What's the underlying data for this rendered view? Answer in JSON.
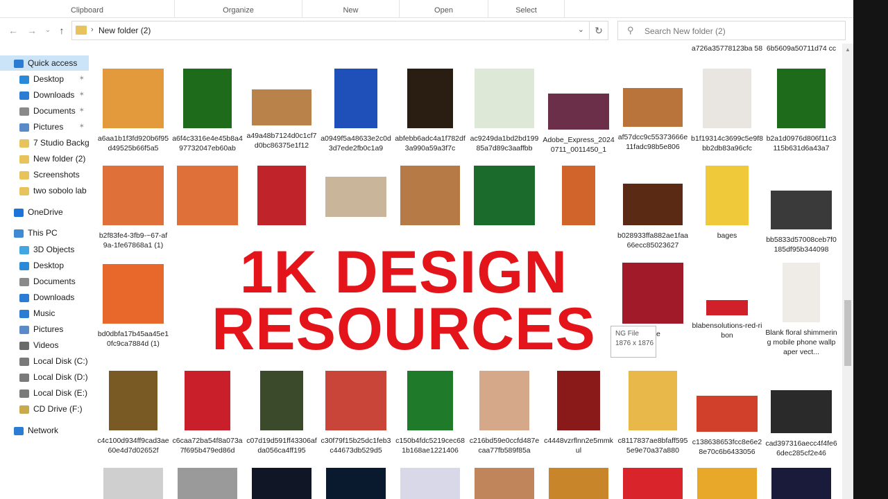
{
  "ribbon": [
    "Clipboard",
    "Organize",
    "New",
    "Open",
    "Select"
  ],
  "address": {
    "path": "New folder (2)"
  },
  "search": {
    "placeholder": "Search New folder (2)"
  },
  "nav": {
    "items": [
      {
        "label": "Quick access",
        "color": "#2b7cd3",
        "pinned": false,
        "selected": true
      },
      {
        "label": "Desktop",
        "color": "#2b8ad8",
        "pinned": true
      },
      {
        "label": "Downloads",
        "color": "#2b7cd3",
        "pinned": true
      },
      {
        "label": "Documents",
        "color": "#8a8a8a",
        "pinned": true
      },
      {
        "label": "Pictures",
        "color": "#5a8ac8",
        "pinned": true
      },
      {
        "label": "7 Studio Backg",
        "color": "#e8c35c",
        "pinned": false
      },
      {
        "label": "New folder (2)",
        "color": "#e8c35c",
        "pinned": false
      },
      {
        "label": "Screenshots",
        "color": "#e8c35c",
        "pinned": false
      },
      {
        "label": "two sobolo lab",
        "color": "#e8c35c",
        "pinned": false
      },
      {
        "label": "OneDrive",
        "color": "#1d74d8",
        "pinned": false
      },
      {
        "label": "This PC",
        "color": "#3e8ad3",
        "pinned": false
      },
      {
        "label": "3D Objects",
        "color": "#41a7e0",
        "pinned": false
      },
      {
        "label": "Desktop",
        "color": "#2b8ad8",
        "pinned": false
      },
      {
        "label": "Documents",
        "color": "#8a8a8a",
        "pinned": false
      },
      {
        "label": "Downloads",
        "color": "#2b7cd3",
        "pinned": false
      },
      {
        "label": "Music",
        "color": "#2b7cd3",
        "pinned": false
      },
      {
        "label": "Pictures",
        "color": "#5a8ac8",
        "pinned": false
      },
      {
        "label": "Videos",
        "color": "#6a6a6a",
        "pinned": false
      },
      {
        "label": "Local Disk (C:)",
        "color": "#7a7a7a",
        "pinned": false
      },
      {
        "label": "Local Disk (D:)",
        "color": "#7a7a7a",
        "pinned": false
      },
      {
        "label": "Local Disk (E:)",
        "color": "#7a7a7a",
        "pinned": false
      },
      {
        "label": "CD Drive (F:)",
        "color": "#c9a94a",
        "pinned": false
      },
      {
        "label": "Network",
        "color": "#2b7cd3",
        "pinned": false
      }
    ]
  },
  "files": {
    "row0": [
      "a726a35778123ba 58",
      "6b5609a50711d74 cc"
    ],
    "row1": [
      {
        "name": "a6aa1b1f3fd920b6f95d49525b66f5a5",
        "color": "#e39a3c"
      },
      {
        "name": "a6f4c3316e4e45b8a497732047eb60ab",
        "color": "#1f6b1c"
      },
      {
        "name": "a49a48b7124d0c1cf7d0bc86375e1f12",
        "color": "#b9824a"
      },
      {
        "name": "a0949f5a48633e2c0d3d7ede2fb0c1a9",
        "color": "#1f4fb8"
      },
      {
        "name": "abfebb6adc4a1f782df3a990a59a3f7c",
        "color": "#2a1e12"
      },
      {
        "name": "ac9249da1bd2bd19985a7d89c3aaffbb",
        "color": "#dde8d6"
      },
      {
        "name": "Adobe_Express_20240711_0011450_1",
        "color": "#6b2f4a"
      },
      {
        "name": "af57dcc9c55373666e11fadc98b5e806",
        "color": "#b8743a"
      },
      {
        "name": "b1f19314c3699c5e9f8bb2db83a96cfc",
        "color": "#e9e5e0"
      },
      {
        "name": "b2a1d0976d806f11c3115b631d6a43a7",
        "color": "#1f6b1c"
      }
    ],
    "row2": [
      {
        "name": "b2f83fe4-3fb9-~67-af9a-1fe67868a1 (1)",
        "color": "#e0703a"
      },
      {
        "name": "",
        "color": "#e0703a"
      },
      {
        "name": "",
        "color": "#c0232a"
      },
      {
        "name": "",
        "color": "#c9b59a"
      },
      {
        "name": "",
        "color": "#b57a45"
      },
      {
        "name": "",
        "color": "#1a6b2c"
      },
      {
        "name": "",
        "color": "#d0642a"
      },
      {
        "name": "b028933ffa882ae1faa66ecc85023627",
        "color": "#5a2a14"
      },
      {
        "name": "bages",
        "color": "#f0c93a"
      },
      {
        "name": "bb5833d57008ceb7f0185df95b344098",
        "color": "#3a3a3a"
      }
    ],
    "row3": [
      {
        "name": "bd0dbfa17b45aa45e10fc9ca7884d (1)",
        "color": "#e8672a"
      },
      {
        "name": "juice",
        "color": "#a01a2a"
      },
      {
        "name": "blabensolutions-red-ribon",
        "color": "#d0202a"
      },
      {
        "name": "Blank floral shimmering mobile phone wallpaper vect...",
        "color": "#efebe6"
      }
    ],
    "row4": [
      {
        "name": "c4c100d934ff9cad3ae60e4d7d02652f",
        "color": "#7a5a24"
      },
      {
        "name": "c6caa72ba54f8a073a7f695b479ed86d",
        "color": "#c81f2a"
      },
      {
        "name": "c07d19d591ff43306afda056ca4ff195",
        "color": "#3a4a2a"
      },
      {
        "name": "c30f79f15b25dc1feb3c44673db529d5",
        "color": "#c9453a"
      },
      {
        "name": "c150b4fdc5219cec681b168ae1221406",
        "color": "#1f7a2a"
      },
      {
        "name": "c216bd59e0ccfd487ecaa77fb589f85a",
        "color": "#d4a888"
      },
      {
        "name": "c4448vzrflnn2e5mmkul",
        "color": "#8a1a1a"
      },
      {
        "name": "c8117837ae8bfaff5955e9e70a37a880",
        "color": "#e8b84a"
      },
      {
        "name": "c138638653fcc8e6e28e70c6b6433056",
        "color": "#d0402a"
      },
      {
        "name": "cad397316aecc4f4fe66dec285cf2e46",
        "color": "#2a2a2a"
      }
    ],
    "row5": [
      "#cfcfcf",
      "#9a9a9a",
      "#101626",
      "#0a1a2e",
      "#d8d8e8",
      "#c0855a",
      "#c9852a",
      "#d8242a",
      "#e8a82a",
      "#1a1a3a"
    ]
  },
  "overlay": {
    "line1": "1K DESIGN",
    "line2": "RESOURCES"
  },
  "tooltip": {
    "line1": "NG File",
    "line2": "1876 x 1876"
  }
}
